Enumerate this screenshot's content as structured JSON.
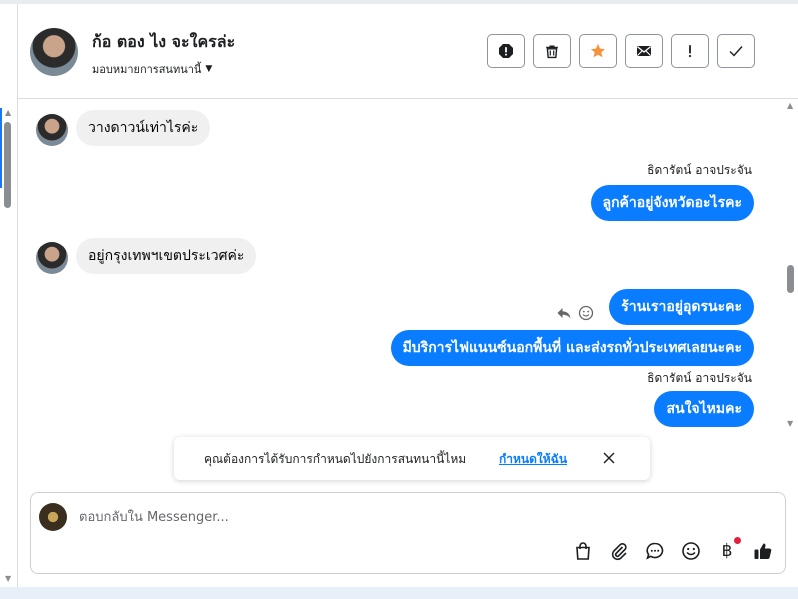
{
  "header": {
    "contact_name": "ก้อ ตอง ไง จะใครล่ะ",
    "assign_label": "มอบหมายการสนทนานี้",
    "toolbar": {
      "spam": "exclamation-circle-icon",
      "delete": "trash-icon",
      "star": "star-icon",
      "unread": "envelope-icon",
      "follow_up": "exclamation-icon",
      "done": "check-icon"
    }
  },
  "colors": {
    "accent": "#0a7cff",
    "star": "#f7923b",
    "incoming_bubble": "#f0f0f0"
  },
  "messages": [
    {
      "direction": "in",
      "text": "วางดาวน์เท่าไรค่ะ"
    },
    {
      "direction": "out",
      "sender": "ธิดารัตน์ อาจประจัน",
      "text": "ลูกค้าอยู่จังหวัดอะไรคะ"
    },
    {
      "direction": "in",
      "text": "อยู่กรุงเทพฯเขตประเวศค่ะ"
    },
    {
      "direction": "out",
      "text": "ร้านเราอยู่อุดรนะคะ"
    },
    {
      "direction": "out",
      "text": "มีบริการไฟแนนซ์นอกพื้นที่ และส่งรถทั่วประเทศเลยนะคะ"
    },
    {
      "direction": "out",
      "sender": "ธิดารัตน์ อาจประจัน",
      "text": "สนใจไหมคะ"
    }
  ],
  "prompt": {
    "text": "คุณต้องการได้รับการกำหนดไปยังการสนทนานี้ไหม",
    "link": "กำหนดให้ฉัน"
  },
  "composer": {
    "placeholder": "ตอบกลับใน Messenger...",
    "currency_symbol": "฿"
  }
}
